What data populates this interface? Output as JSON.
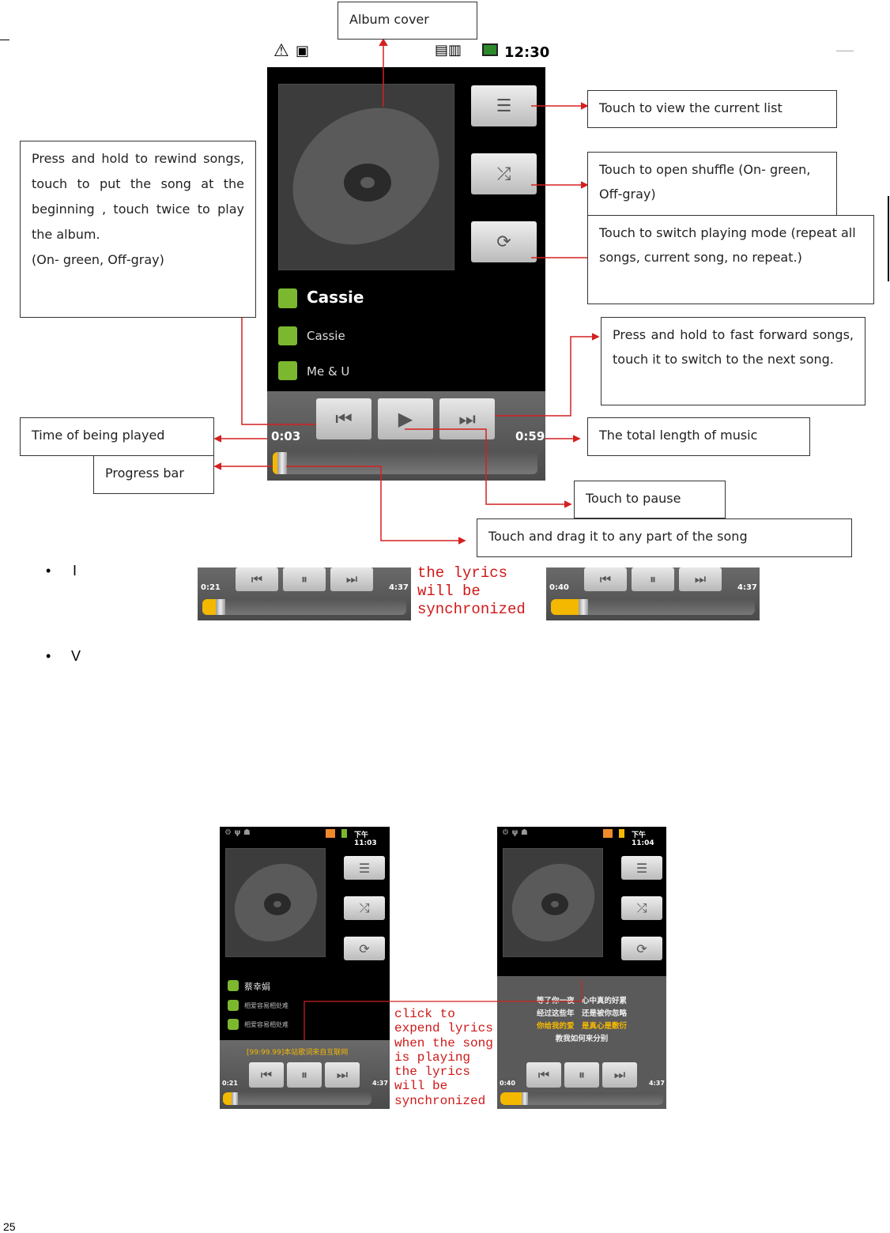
{
  "main_figure": {
    "status_time": "12:30",
    "track_artist": "Cassie",
    "track_album": "Cassie",
    "track_song": "Me & U",
    "time_elapsed": "0:03",
    "time_total": "0:59",
    "progress_percent": 3,
    "callouts": {
      "album_cover": "Album cover",
      "current_list": "Touch to view the current list",
      "shuffle": "Touch to open shuffle (On- green, Off-gray)",
      "repeat": "Touch to switch playing mode (repeat all songs, current song, no repeat.)",
      "rewind": "Press and hold to rewind songs, touch to put the song at the beginning , touch twice to play the album.",
      "rewind_note": "(On- green, Off-gray)",
      "fast_forward": "Press and hold to fast forward songs, touch it to switch to the next song.",
      "time_played": "Time of being played",
      "progress_bar": "Progress bar",
      "total_length": "The total length of music",
      "pause": "Touch to pause",
      "drag": "Touch and drag it to any part of the song"
    }
  },
  "bullets": [
    {
      "text": "I"
    },
    {
      "text": "V"
    }
  ],
  "strip": {
    "left_elapsed": "0:21",
    "left_total": "4:37",
    "left_progress_percent": 8,
    "caption": "the lyrics will be synchronized",
    "right_elapsed": "0:40",
    "right_total": "4:37",
    "right_progress_percent": 15
  },
  "lyrics_figure": {
    "left": {
      "status_time": "下午 11:03",
      "artist": "蔡幸娟",
      "album": "相爱容易相处难",
      "song": "相爱容易相处难",
      "lyric_line": "[99:99.99]本站歌词来自互联网",
      "elapsed": "0:21",
      "total": "4:37",
      "progress_percent": 8
    },
    "caption": "click to expend lyrics when the song is playing the lyrics will be synchronized",
    "right": {
      "status_time": "下午 11:04",
      "lyrics": [
        "等了你一夜　心中真的好累",
        "经过这些年　还是被你忽略",
        "你给我的爱　是真心是敷衍",
        "教我如何来分别"
      ],
      "elapsed": "0:40",
      "total": "4:37",
      "progress_percent": 15
    },
    "highlight_color": "#f5b800"
  },
  "page_number": "25",
  "colors": {
    "callout_line": "#d42020",
    "progress": "#f5b800",
    "icon_green": "#7cb82f"
  }
}
